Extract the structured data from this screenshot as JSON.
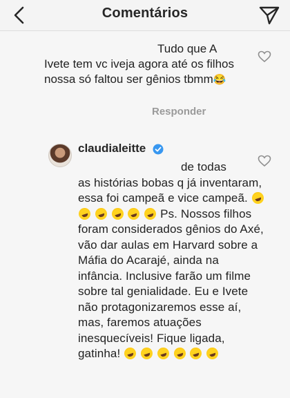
{
  "header": {
    "title": "Comentários",
    "back_icon": "chevron-left-icon",
    "send_icon": "paper-plane-icon"
  },
  "comment1": {
    "line1": "Tudo que A",
    "rest": "Ivete tem vc iveja agora até os filhos nossa só faltou ser gênios tbmm",
    "emoji": "😂",
    "reply_label": "Responder"
  },
  "comment2": {
    "username": "claudialeitte",
    "first": "de todas",
    "part1": "as histórias bobas q já inventaram, essa foi campeã e vice campeã.",
    "part2": "Ps. Nossos filhos foram considerados gênios do Axé, vão dar aulas em Harvard sobre a Máfia do Acarajé, ainda na infância. Inclusive farão um filme sobre tal genialidade. Eu e Ivete não protagonizaremos esse aí, mas, faremos atuações inesquecíveis! Fique ligada, gatinha!",
    "emoji_name": "rolling-on-floor-laughing-icon"
  },
  "colors": {
    "background": "#f6f6f6",
    "text": "#262626",
    "muted": "#9a9a9a",
    "verified": "#3897f0"
  }
}
